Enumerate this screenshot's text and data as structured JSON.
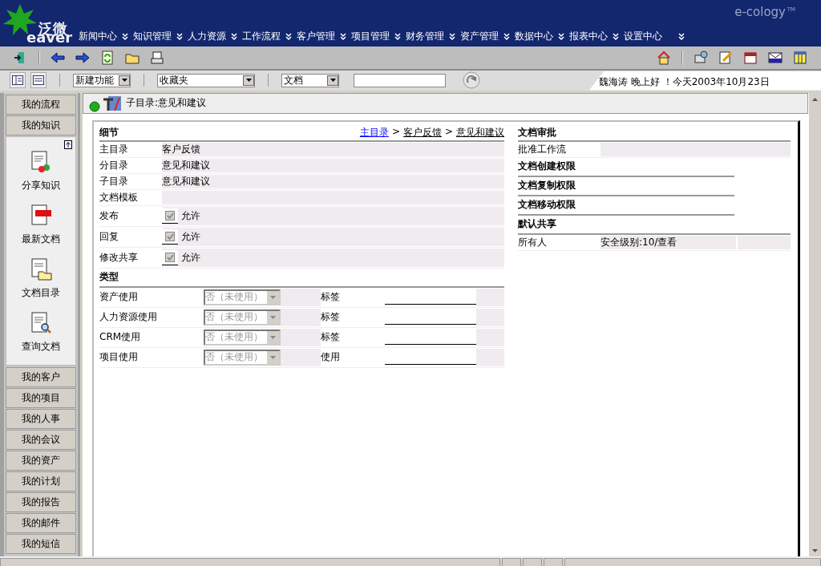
{
  "header": {
    "logo_cn": "泛微",
    "logo_en": "eaver",
    "brand": "e-cology",
    "brand_mark": "TM",
    "menu": [
      {
        "label": "新闻中心"
      },
      {
        "label": "知识管理"
      },
      {
        "label": "人力资源"
      },
      {
        "label": "工作流程"
      },
      {
        "label": "客户管理"
      },
      {
        "label": "项目管理"
      },
      {
        "label": "财务管理"
      },
      {
        "label": "资产管理"
      },
      {
        "label": "数据中心"
      },
      {
        "label": "报表中心"
      },
      {
        "label": "设置中心"
      }
    ]
  },
  "quickbar": {
    "new_function": "新建功能",
    "favorites": "收藏夹",
    "search_type": "文档",
    "greeting": "魏海涛 晚上好 ！今天2003年10月23日"
  },
  "sidebar": {
    "top": [
      {
        "label": "我的流程"
      },
      {
        "label": "我的知识"
      }
    ],
    "tools": [
      {
        "label": "分享知识",
        "kind": "share"
      },
      {
        "label": "最新文档",
        "kind": "new"
      },
      {
        "label": "文档目录",
        "kind": "folder"
      },
      {
        "label": "查询文档",
        "kind": "search"
      }
    ],
    "bottom": [
      {
        "label": "我的客户"
      },
      {
        "label": "我的项目"
      },
      {
        "label": "我的人事"
      },
      {
        "label": "我的会议"
      },
      {
        "label": "我的资产"
      },
      {
        "label": "我的计划"
      },
      {
        "label": "我的报告"
      },
      {
        "label": "我的邮件"
      },
      {
        "label": "我的短信"
      }
    ]
  },
  "page_title": "子目录:意见和建议",
  "details": {
    "heading": "细节",
    "separator": ">",
    "breadcrumb": [
      {
        "label": "主目录",
        "visited": false
      },
      {
        "label": "客户反馈",
        "visited": true
      },
      {
        "label": "意见和建议",
        "visited": true
      }
    ],
    "fields": [
      {
        "kind": "text",
        "label": "主目录",
        "value": "客户反馈"
      },
      {
        "kind": "text",
        "label": "分目录",
        "value": "意见和建议"
      },
      {
        "kind": "text",
        "label": "子目录",
        "value": "意见和建议"
      },
      {
        "kind": "text",
        "label": "文档模板"
      },
      {
        "kind": "checkbox",
        "label": "发布",
        "option": "允许",
        "checked": true,
        "disabled": true
      },
      {
        "kind": "checkbox",
        "label": "回复",
        "option": "允许",
        "checked": true,
        "disabled": true
      },
      {
        "kind": "checkbox",
        "label": "修改共享",
        "option": "允许",
        "checked": true,
        "disabled": true
      }
    ],
    "type_heading": "类型",
    "usage": [
      {
        "label": "资产使用",
        "select": "否（未使用）",
        "field_label": "标签"
      },
      {
        "label": "人力资源使用",
        "select": "否（未使用）",
        "field_label": "标签"
      },
      {
        "label": "CRM使用",
        "select": "否（未使用）",
        "field_label": "标签"
      },
      {
        "label": "项目使用",
        "select": "否（未使用）",
        "field_label": "使用"
      }
    ]
  },
  "permissions": {
    "approval_heading": "文档审批",
    "approval_row": {
      "label": "批准工作流"
    },
    "sections": [
      {
        "heading": "文档创建权限"
      },
      {
        "heading": "文档复制权限"
      },
      {
        "heading": "文档移动权限"
      }
    ],
    "sharing_heading": "默认共享",
    "sharing": [
      {
        "who": "所有人",
        "level": "安全级别:10/查看"
      }
    ]
  }
}
